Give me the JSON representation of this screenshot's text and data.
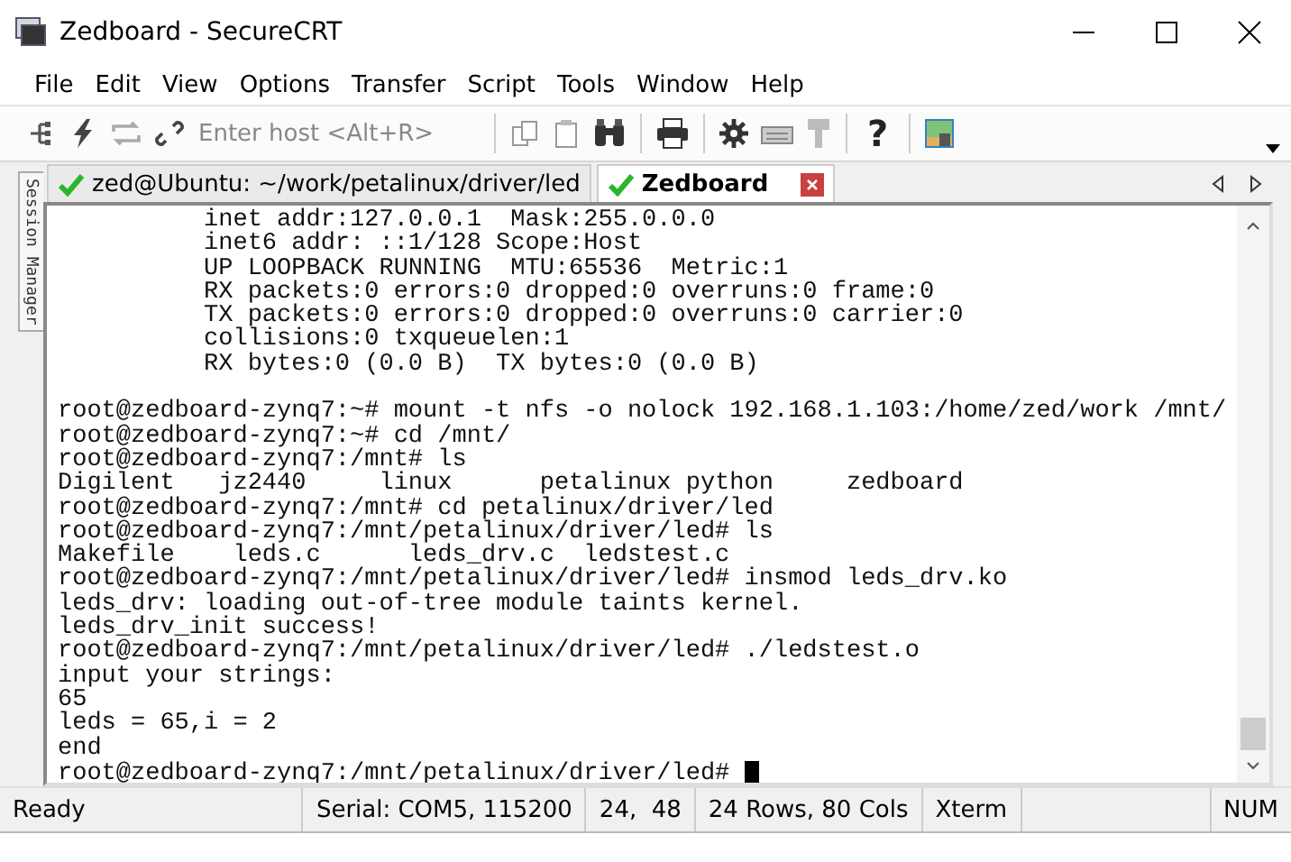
{
  "window": {
    "title": "Zedboard - SecureCRT"
  },
  "menu": [
    "File",
    "Edit",
    "View",
    "Options",
    "Transfer",
    "Script",
    "Tools",
    "Window",
    "Help"
  ],
  "toolbar": {
    "host_field": {
      "placeholder": "Enter host <Alt+R>"
    },
    "help": "?"
  },
  "session_manager": {
    "label": "Session Manager"
  },
  "tabs": [
    {
      "label": "zed@Ubuntu: ~/work/petalinux/driver/led",
      "selected": false,
      "connected": true
    },
    {
      "label": "Zedboard",
      "selected": true,
      "connected": true
    }
  ],
  "terminal": {
    "lines": [
      "          inet addr:127.0.0.1  Mask:255.0.0.0",
      "          inet6 addr: ::1/128 Scope:Host",
      "          UP LOOPBACK RUNNING  MTU:65536  Metric:1",
      "          RX packets:0 errors:0 dropped:0 overruns:0 frame:0",
      "          TX packets:0 errors:0 dropped:0 overruns:0 carrier:0",
      "          collisions:0 txqueuelen:1",
      "          RX bytes:0 (0.0 B)  TX bytes:0 (0.0 B)",
      {
        "kind": "blank"
      },
      "root@zedboard-zynq7:~# mount -t nfs -o nolock 192.168.1.103:/home/zed/work /mnt/",
      "root@zedboard-zynq7:~# cd /mnt/",
      "root@zedboard-zynq7:/mnt# ls",
      "Digilent   jz2440     linux      petalinux python     zedboard",
      "root@zedboard-zynq7:/mnt# cd petalinux/driver/led",
      "root@zedboard-zynq7:/mnt/petalinux/driver/led# ls",
      "Makefile    leds.c      leds_drv.c  ledstest.c",
      "root@zedboard-zynq7:/mnt/petalinux/driver/led# insmod leds_drv.ko",
      "leds_drv: loading out-of-tree module taints kernel.",
      "leds_drv_init success!",
      "root@zedboard-zynq7:/mnt/petalinux/driver/led# ./ledstest.o",
      "input your strings:",
      "65",
      "leds = 65,i = 2",
      "end",
      "root@zedboard-zynq7:/mnt/petalinux/driver/led# "
    ]
  },
  "status_bar": [
    "Ready",
    "Serial: COM5, 115200",
    "24,  48",
    "24 Rows, 80 Cols",
    "Xterm",
    "NUM"
  ]
}
